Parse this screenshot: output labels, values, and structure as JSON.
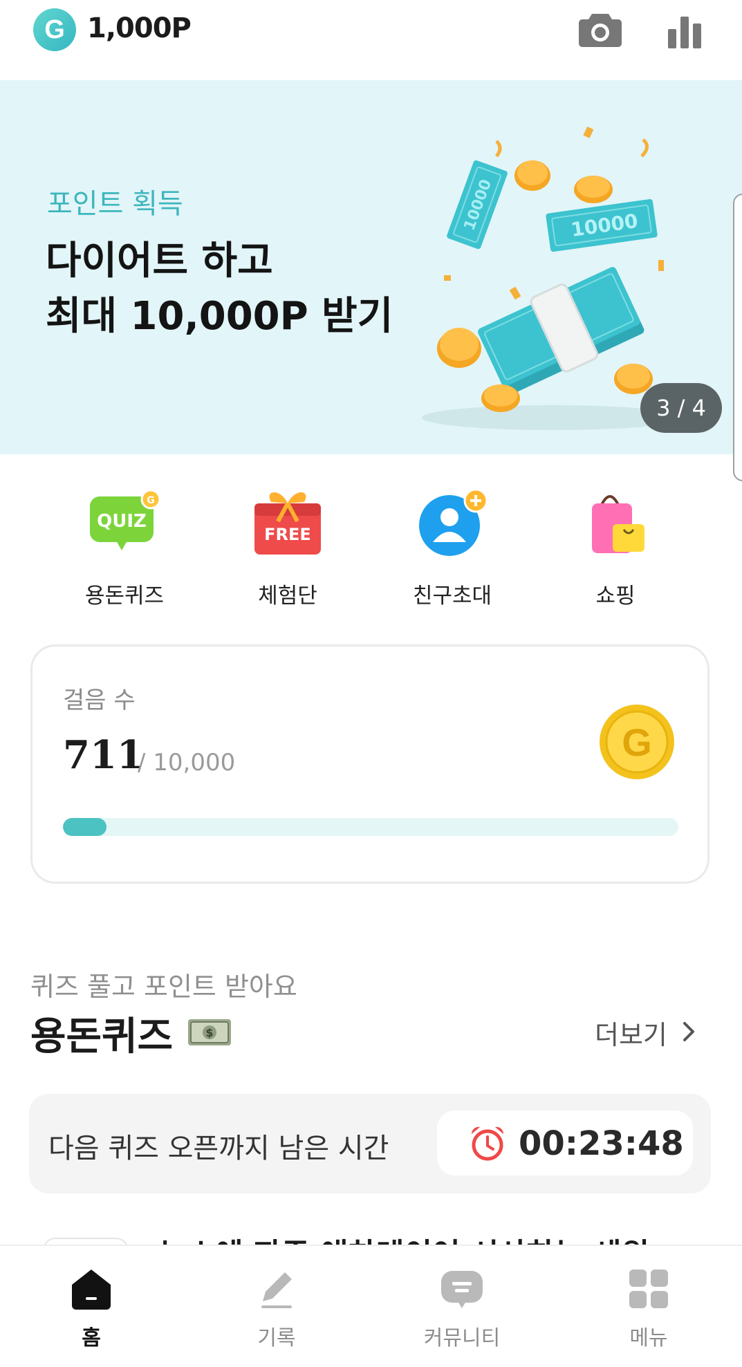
{
  "header": {
    "brand_letter": "G",
    "points": "1,000P",
    "camera_icon": "camera-icon",
    "stats_icon": "bar-chart-icon"
  },
  "banner": {
    "subtitle": "포인트 획득",
    "title_line1": "다이어트  하고",
    "title_line2": "최대 10,000P 받기",
    "pager": "3 / 4",
    "bill_label": "10000",
    "accent": "#3cb6bd",
    "background": "#e2f5f8"
  },
  "quick_menu": [
    {
      "label": "용돈퀴즈",
      "icon": "quiz-icon",
      "icon_text": "QUIZ"
    },
    {
      "label": "체험단",
      "icon": "free-gift-icon",
      "icon_text": "FREE"
    },
    {
      "label": "친구초대",
      "icon": "invite-friend-icon"
    },
    {
      "label": "쇼핑",
      "icon": "shopping-bag-icon"
    }
  ],
  "steps": {
    "label": "걸음 수",
    "value": "711",
    "goal": "/ 10,000",
    "progress_fraction": 0.0711,
    "coin_icon": "g-coin-icon",
    "bar_color": "#4cc2c3"
  },
  "quiz_section": {
    "subtitle": "퀴즈 풀고 포인트 받아요",
    "title": "용돈퀴즈",
    "money_icon": "money-bill-icon",
    "more_label": "더보기",
    "timer_label": "다음 퀴즈 오픈까지 남은 시간",
    "timer_value": "00:23:48",
    "alarm_icon": "alarm-clock-icon",
    "peek_text": "뉴스에 자주 애차레이어 시사하는 세워"
  },
  "bottom_nav": [
    {
      "label": "홈",
      "icon": "home-icon",
      "active": true
    },
    {
      "label": "기록",
      "icon": "pencil-icon",
      "active": false
    },
    {
      "label": "커뮤니티",
      "icon": "chat-bubble-icon",
      "active": false
    },
    {
      "label": "메뉴",
      "icon": "grid-menu-icon",
      "active": false
    }
  ]
}
